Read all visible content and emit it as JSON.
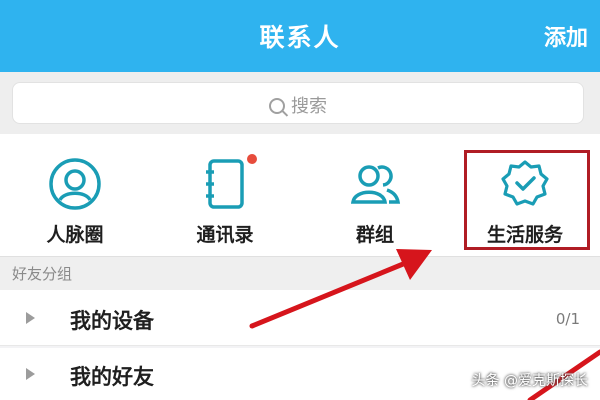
{
  "header": {
    "title": "联系人",
    "add_label": "添加",
    "background": "#2fb3ef"
  },
  "search": {
    "placeholder": "搜索",
    "icon": "search-icon"
  },
  "quick_actions": [
    {
      "label": "人脉圈",
      "icon": "contacts-circle-icon"
    },
    {
      "label": "通讯录",
      "icon": "address-book-icon",
      "badge": true
    },
    {
      "label": "群组",
      "icon": "group-icon"
    },
    {
      "label": "生活服务",
      "icon": "service-badge-icon",
      "highlighted": true
    }
  ],
  "section": {
    "title": "好友分组"
  },
  "groups": [
    {
      "label": "我的设备",
      "count": "0/1"
    },
    {
      "label": "我的好友",
      "count": ""
    }
  ],
  "colors": {
    "accent": "#2fb3ef",
    "icon_teal": "#1a9db5",
    "highlight": "#b01c24",
    "badge": "#e74c3c"
  },
  "watermark": "头条 @爱克斯探长"
}
